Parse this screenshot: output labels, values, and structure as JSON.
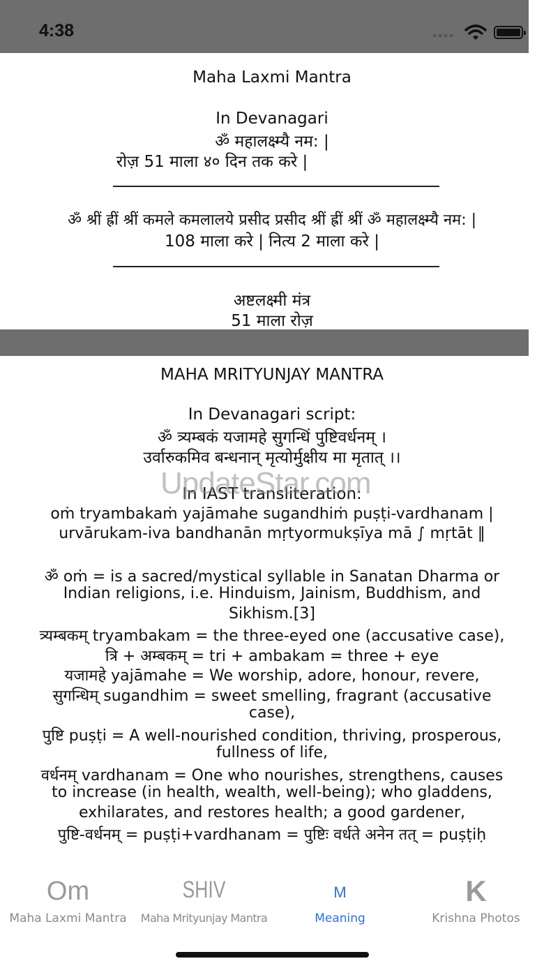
{
  "status_bar": {
    "time": "4:38"
  },
  "section1": {
    "title": "Maha Laxmi Mantra",
    "subtitle": "In Devanagari",
    "mantra_line1": "ॐ महालक्ष्म्यै नम: |",
    "instruction1": "रोज़ 51 माला ४० दिन तक करे |",
    "rule1": "___________________________________",
    "mantra_line2": "ॐ श्रीं ह्रीं श्रीं कमले कमलालये प्रसीद प्रसीद श्रीं ह्रीं श्रीं ॐ महालक्ष्म्यै नम: |",
    "instruction2": "108 माला करे | नित्य 2 माला करे |",
    "rule2": "___________________________________",
    "ashtalakshmi": "अष्टलक्ष्मी मंत्र",
    "instruction3": "51 माला रोज़"
  },
  "section2": {
    "title": "MAHA MRITYUNJAY MANTRA",
    "dev_heading": "In Devanagari script:",
    "dev_line1": "ॐ त्र्यम्बकं यजामहे सुगन्धिं पुष्टिवर्धनम् ।",
    "dev_line2": "उर्वारुकमिव बन्धनान् मृत्योर्मुक्षीय मा मृतात् ।।",
    "iast_heading": "In IAST transliteration:",
    "iast_line1": "oṁ tryambakaṁ yajāmahe sugandhiṁ puṣṭi-vardhanam |",
    "iast_line2": "urvārukam-iva bandhanān mṛtyormukṣīya mā ∫ mṛtāt ‖",
    "meanings": [
      "ॐ oṁ = is a sacred/mystical syllable in Sanatan Dharma or",
      "Indian religions, i.e. Hinduism, Jainism, Buddhism, and",
      "Sikhism.[3]",
      "त्र्यम्बकम् tryambakam = the three-eyed one (accusative case),",
      "त्रि + अम्बकम् = tri + ambakam = three + eye",
      "यजामहे yajāmahe = We worship, adore, honour, revere,",
      "सुगन्धिम् sugandhim = sweet smelling, fragrant (accusative",
      "case),",
      "पुष्टि puṣṭi = A well-nourished condition, thriving, prosperous,",
      "fullness of life,",
      "वर्धनम् vardhanam = One who nourishes, strengthens, causes",
      "to increase (in health, wealth, well-being); who gladdens,",
      "exhilarates, and restores health; a good gardener,",
      "पुष्टि-वर्धनम् = puṣṭi+vardhanam = पुष्टिः वर्धते अनेन तत् = puṣṭiḥ"
    ]
  },
  "watermark": "UpdateStar.com",
  "tabs": [
    {
      "icon_text": "Om",
      "label": "Maha Laxmi Mantra"
    },
    {
      "icon_text": "SHIV",
      "label": "Maha Mrityunjay Mantra"
    },
    {
      "icon_text": "M",
      "label": "Meaning"
    },
    {
      "icon_text": "K",
      "label": "Krishna Photos"
    }
  ],
  "colors": {
    "active_tab": "#2f6fe0",
    "inactive_tab": "#8a8a8a",
    "status_bar_bg": "#6e6e6e"
  }
}
